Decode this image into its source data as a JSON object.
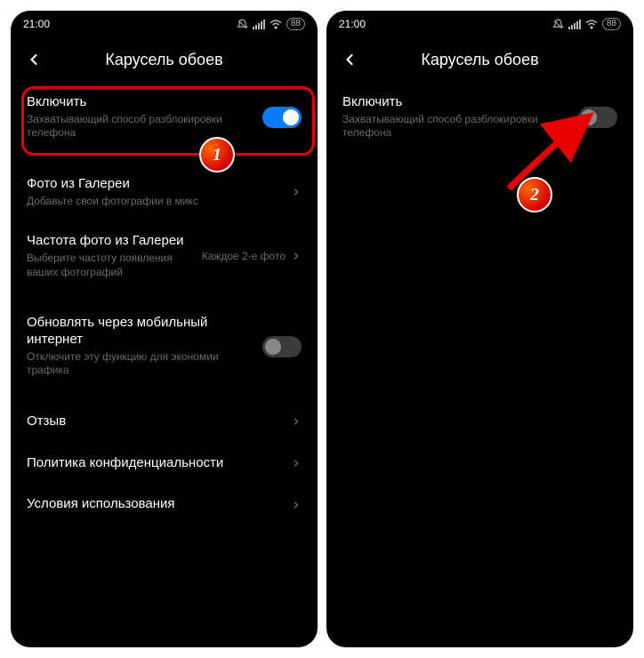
{
  "statusbar": {
    "time": "21:00",
    "battery": "88"
  },
  "header": {
    "title": "Карусель обоев"
  },
  "left": {
    "enable": {
      "title": "Включить",
      "sub": "Захватывающий способ разблокировки телефона"
    },
    "gallery": {
      "title": "Фото из Галереи",
      "sub": "Добавьте свои фотографии в микс"
    },
    "freq": {
      "title": "Частота фото из Галереи",
      "sub": "Выберите частоту появления ваших фотографий",
      "value": "Каждое 2-е фото"
    },
    "mobile": {
      "title": "Обновлять через мобильный интернет",
      "sub": "Отключите эту функцию для экономии трафика"
    },
    "feedback": {
      "title": "Отзыв"
    },
    "privacy": {
      "title": "Политика конфиденциальности"
    },
    "terms": {
      "title": "Условия использования"
    }
  },
  "right": {
    "enable": {
      "title": "Включить",
      "sub": "Захватывающий способ разблокировки телефона"
    }
  },
  "badges": {
    "b1": "1",
    "b2": "2"
  }
}
